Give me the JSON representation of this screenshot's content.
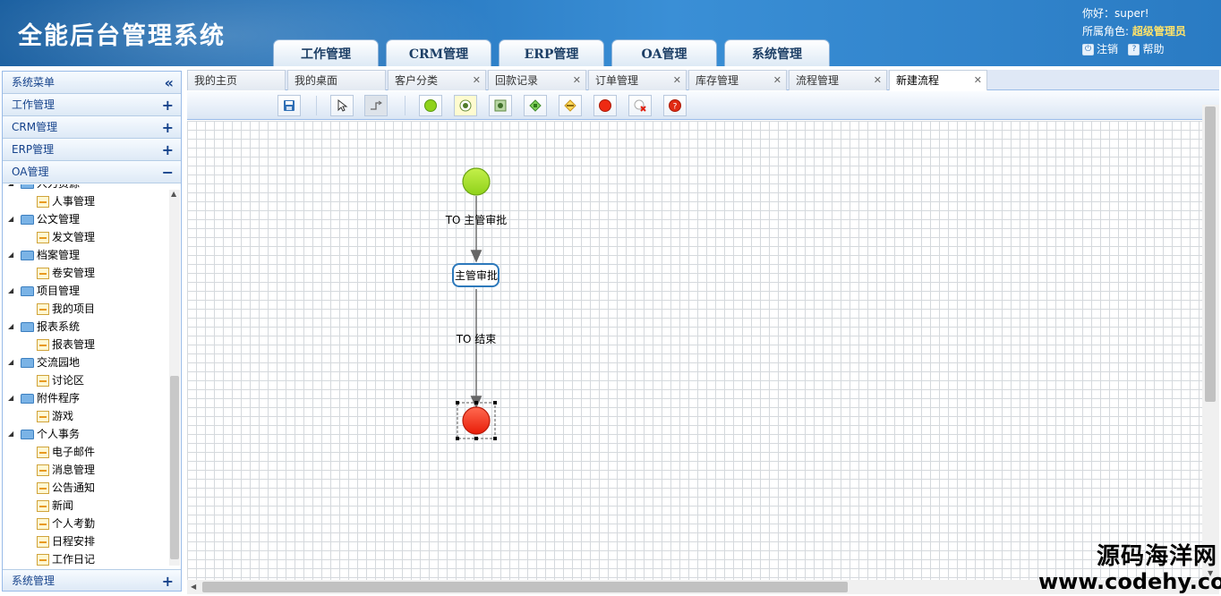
{
  "header": {
    "app_title": "全能后台管理系统",
    "nav_tabs": [
      "工作管理",
      "CRM管理",
      "ERP管理",
      "OA管理",
      "系统管理"
    ],
    "greeting": "你好：super!",
    "role_label": "所属角色:",
    "role_value": "超级管理员",
    "logout_label": "注销",
    "help_label": "帮助"
  },
  "sidebar": {
    "title": "系统菜单",
    "collapse_icon": "«",
    "sections": [
      {
        "label": "工作管理",
        "toggle": "+"
      },
      {
        "label": "CRM管理",
        "toggle": "+"
      },
      {
        "label": "ERP管理",
        "toggle": "+"
      },
      {
        "label": "OA管理",
        "toggle": "−"
      }
    ],
    "bottom_section": {
      "label": "系统管理",
      "toggle": "+"
    },
    "tree": [
      {
        "label": "人力资源",
        "type": "folder"
      },
      {
        "label": "人事管理",
        "type": "leaf"
      },
      {
        "label": "公文管理",
        "type": "folder"
      },
      {
        "label": "发文管理",
        "type": "leaf"
      },
      {
        "label": "档案管理",
        "type": "folder"
      },
      {
        "label": "卷安管理",
        "type": "leaf"
      },
      {
        "label": "项目管理",
        "type": "folder"
      },
      {
        "label": "我的项目",
        "type": "leaf"
      },
      {
        "label": "报表系统",
        "type": "folder"
      },
      {
        "label": "报表管理",
        "type": "leaf"
      },
      {
        "label": "交流园地",
        "type": "folder"
      },
      {
        "label": "讨论区",
        "type": "leaf"
      },
      {
        "label": "附件程序",
        "type": "folder"
      },
      {
        "label": "游戏",
        "type": "leaf"
      },
      {
        "label": "个人事务",
        "type": "folder"
      },
      {
        "label": "电子邮件",
        "type": "leaf"
      },
      {
        "label": "消息管理",
        "type": "leaf"
      },
      {
        "label": "公告通知",
        "type": "leaf"
      },
      {
        "label": "新闻",
        "type": "leaf"
      },
      {
        "label": "个人考勤",
        "type": "leaf"
      },
      {
        "label": "日程安排",
        "type": "leaf"
      },
      {
        "label": "工作日记",
        "type": "leaf"
      }
    ]
  },
  "page_tabs": [
    {
      "label": "我的主页",
      "closable": false,
      "active": false
    },
    {
      "label": "我的桌面",
      "closable": false,
      "active": false
    },
    {
      "label": "客户分类",
      "closable": true,
      "active": false
    },
    {
      "label": "回款记录",
      "closable": true,
      "active": false
    },
    {
      "label": "订单管理",
      "closable": true,
      "active": false
    },
    {
      "label": "库存管理",
      "closable": true,
      "active": false
    },
    {
      "label": "流程管理",
      "closable": true,
      "active": false
    },
    {
      "label": "新建流程",
      "closable": true,
      "active": true
    }
  ],
  "toolbar": {
    "buttons": [
      "save-icon",
      "pointer-icon",
      "connector-icon",
      "start-node-icon",
      "task-node-icon",
      "subprocess-icon",
      "decision-icon",
      "fork-icon",
      "end-node-icon",
      "cancel-end-icon",
      "error-end-icon"
    ]
  },
  "flow": {
    "start_color": "#99dd22",
    "end_color": "#ee2a12",
    "task_label": "主管审批",
    "edge1_label": "TO 主管审批",
    "edge2_label": "TO 结束"
  },
  "watermark": {
    "line1": "源码海洋网",
    "line2": "www.codehy.com"
  }
}
